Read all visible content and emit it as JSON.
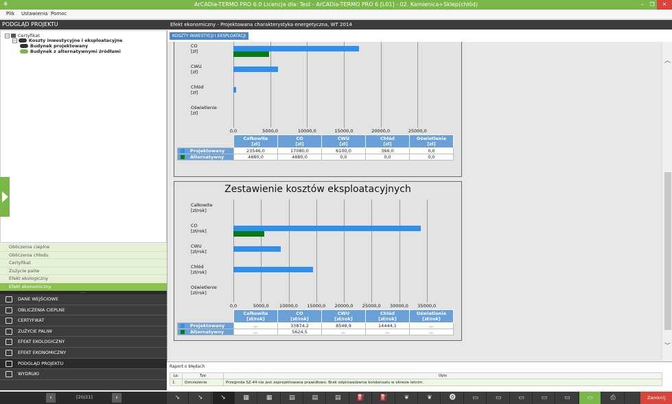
{
  "window": {
    "title": "ArCADia-TERMO PRO 6.0 Licencja dla: Test - ArCADia-TERMO PRO 6 [L01] - 02. Kamienica+Sklep(chłód)",
    "app_icon": "arcadia-logo-icon",
    "controls": {
      "minimize": "–",
      "restore": "❐",
      "close": "✕"
    }
  },
  "menu": {
    "items": [
      "Plik",
      "Ustawienia",
      "Pomoc"
    ]
  },
  "toolbar": {
    "icons": [
      "save-icon",
      "swap-icon",
      "copy-icon",
      "undo-icon",
      "dropdown-icon",
      "redo-icon",
      "dropdown-icon",
      "help-icon"
    ],
    "glyphs": [
      "🖫",
      "⇄",
      "⎘",
      "↶",
      "▾",
      "↷",
      "▾",
      "?"
    ]
  },
  "left_panel": {
    "header": "PODGLĄD PROJEKTU",
    "tree": [
      {
        "label": "Certyfikat",
        "level": 0,
        "bold": false,
        "icon": "list-icon",
        "toggle": "⊟"
      },
      {
        "label": "Koszty inwestycyjne i eksploatacyjne",
        "level": 1,
        "bold": true,
        "icon": "circle-icon",
        "toggle": "⊟",
        "badge": "0"
      },
      {
        "label": "Budynek projektowany",
        "level": 2,
        "bold": true,
        "icon": "pill-icon",
        "badge": "O"
      },
      {
        "label": "Budynek z alternatywnymi źródłami",
        "level": 2,
        "bold": true,
        "icon": "pill-icon",
        "badge": "B"
      }
    ],
    "subnav": [
      "Obliczenia cieplne",
      "Obliczenia chłodu",
      "Certyfikat",
      "Zużycie paliw",
      "Efekt ekologiczny",
      "Efekt ekonomiczny"
    ],
    "subnav_active": 5,
    "subnav_dots": ".....",
    "mainnav": [
      "DANE WEJŚCIOWE",
      "OBLICZENIA CIEPLNE",
      "CERTYFIKAT",
      "ZUŻYCIE PALIW",
      "EFEKT EKOLOGICZNY",
      "EFEKT EKONOMICZNY",
      "PODGLĄD PROJEKTU",
      "WYDRUKI"
    ],
    "mainnav_active": 6,
    "pager": {
      "prev": "‹",
      "next": "›",
      "label": "[20/21]"
    }
  },
  "right_panel": {
    "header": "Efekt ekonomiczny - Projektowana charakterystyka energetyczna, WT 2014",
    "tab": "KOSZTY INWESTYCJI I EKSPLOATACJI"
  },
  "colors": {
    "projektowany": "#2f8ff0",
    "alternatywny": "#0a7a12",
    "accent": "#7ab648",
    "header": "#6aa0d8"
  },
  "chart_data": [
    {
      "type": "bar",
      "orientation": "horizontal",
      "title": "",
      "categories": [
        "CO\n[zł]",
        "CWU\n[zł]",
        "Chłód\n[zł]",
        "Oświetlenie\n[zł]"
      ],
      "xlim": [
        0,
        30000
      ],
      "xticks": [
        "0,0",
        "5000,0",
        "10000,0",
        "15000,0",
        "20000,0",
        "25000,0"
      ],
      "series": [
        {
          "name": "Projektowany",
          "values": [
            17080,
            6100,
            366,
            0
          ]
        },
        {
          "name": "Alternatywny",
          "values": [
            4880,
            0,
            0,
            0
          ]
        }
      ],
      "table": {
        "columns": [
          "Całkowite\n[zł]",
          "CO\n[zł]",
          "CWU\n[zł]",
          "Chłód\n[zł]",
          "Oświetlenie\n[zł]"
        ],
        "rows": [
          {
            "name": "Projektowany",
            "cells": [
              "23546,0",
              "17080,0",
              "6100,0",
              "366,0",
              "0,0"
            ]
          },
          {
            "name": "Alternatywny",
            "cells": [
              "4880,0",
              "4880,0",
              "0,0",
              "0,0",
              "0,0"
            ]
          }
        ]
      }
    },
    {
      "type": "bar",
      "orientation": "horizontal",
      "title": "Zestawienie kosztów eksploatacyjnych",
      "categories": [
        "Całkowite\n[zł/rok]",
        "CO\n[zł/rok]",
        "CWU\n[zł/rok]",
        "Chłód\n[zł/rok]",
        "Oświetlenie\n[zł/rok]"
      ],
      "xlim": [
        0,
        40000
      ],
      "xticks": [
        "0,0",
        "5000,0",
        "10000,0",
        "15000,0",
        "20000,0",
        "25000,0",
        "30000,0",
        "35000,0"
      ],
      "series": [
        {
          "name": "Projektowany",
          "values": [
            0,
            33874.2,
            8548.9,
            14444.1,
            0
          ]
        },
        {
          "name": "Alternatywny",
          "values": [
            0,
            5624.5,
            0,
            0,
            0
          ]
        }
      ],
      "table": {
        "columns": [
          "Całkowite\n[zł/rok]",
          "CO\n[zł/rok]",
          "CWU\n[zł/rok]",
          "Chłód\n[zł/rok]",
          "Oświetlenie\n[zł/rok]"
        ],
        "rows": [
          {
            "name": "Projektowany",
            "cells": [
              "...",
              "33874,2",
              "8548,9",
              "14444,1",
              "..."
            ]
          },
          {
            "name": "Alternatywny",
            "cells": [
              "...",
              "5624,5",
              "...",
              "...",
              "..."
            ]
          }
        ]
      }
    }
  ],
  "errors": {
    "title": "Raport o błędach",
    "columns": [
      "Lp.",
      "Typ",
      "Opis"
    ],
    "rows": [
      {
        "lp": "1",
        "type": "Ostrzeżenie",
        "desc": "Przegroda SZ-44 nie jest zaprojektowana prawidłowo. Brak odprowadzenia kondensatu w okresie letnim."
      }
    ]
  },
  "bottombar": {
    "close_label": "Zamknij",
    "buttons": [
      "doc-arrow-icon",
      "doc-arrow-icon",
      "doc-arrow-icon",
      "building-icon",
      "building-icon",
      "building-icon",
      "building-icon",
      "building-icon",
      "fuel-icon",
      "fuel-icon",
      "leaf-icon",
      "leaf-icon",
      "coin-icon",
      "report-icon",
      "report-icon",
      "report-icon",
      "report-icon",
      "report-icon",
      "report-icon",
      "print-icon"
    ],
    "glyphs": [
      "➘",
      "➘",
      "➘",
      "▦",
      "▦",
      "▤",
      "▤",
      "▤",
      "⛽",
      "⛽",
      "❦",
      "❦",
      "⓿",
      "▭",
      "▭",
      "▭",
      "▭",
      "▭",
      "▭",
      "⎙"
    ]
  }
}
